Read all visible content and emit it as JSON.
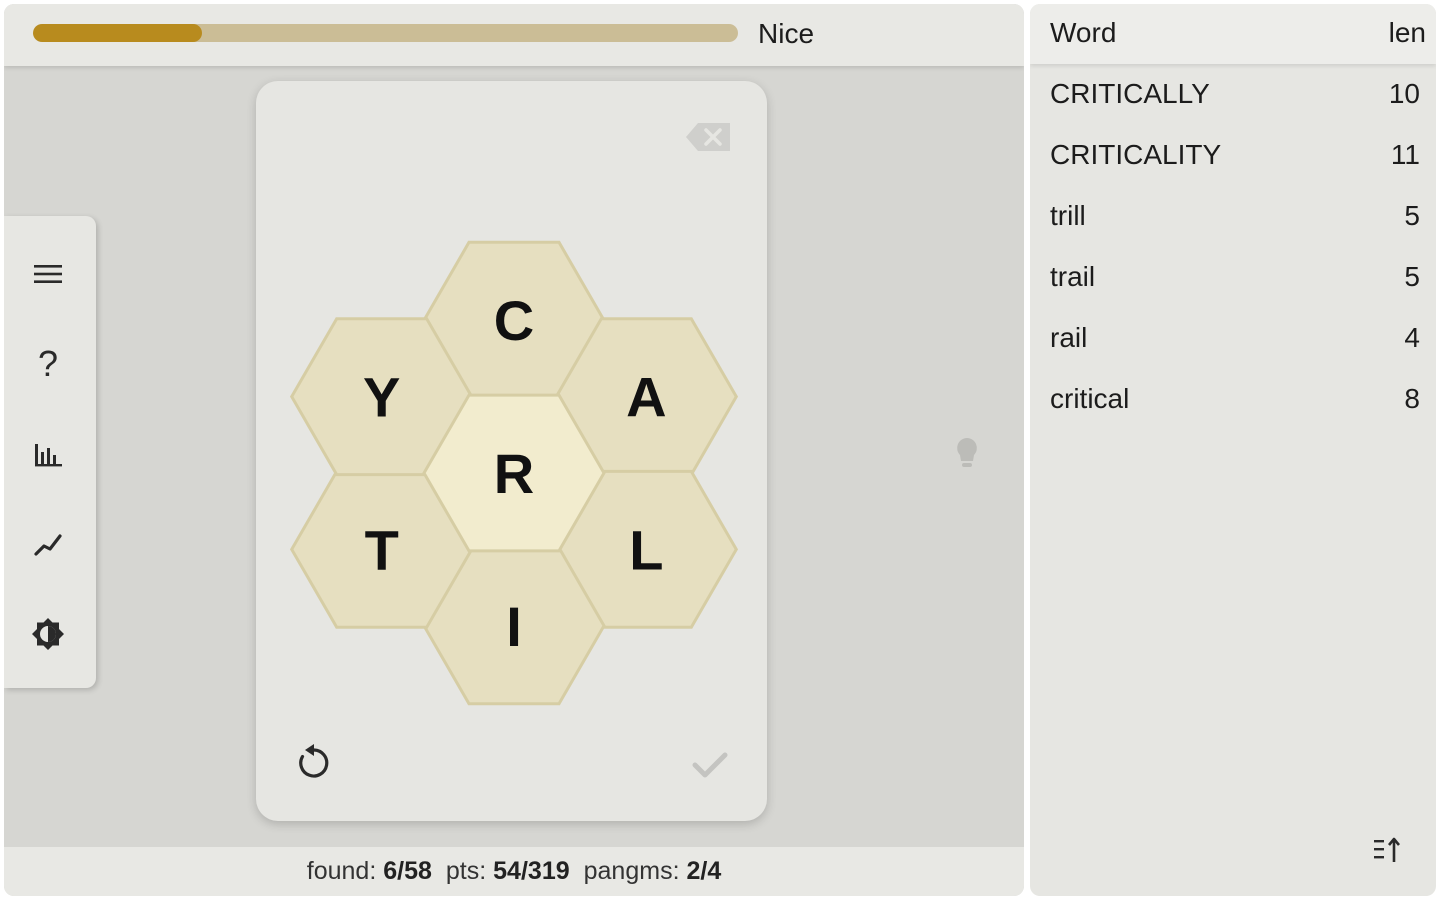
{
  "progress": {
    "fraction": 0.24,
    "rank": "Nice"
  },
  "toolbar": {
    "icons": [
      "menu-icon",
      "help-icon",
      "stats-icon",
      "trend-icon",
      "theme-icon"
    ],
    "help_glyph": "?"
  },
  "hive": {
    "center": "R",
    "outer": [
      "C",
      "A",
      "L",
      "I",
      "T",
      "Y"
    ]
  },
  "status": {
    "found_label": "found:",
    "found": "6/58",
    "pts_label": "pts:",
    "pts": "54/319",
    "pangrams_label": "pangms:",
    "pangrams": "2/4"
  },
  "word_list": {
    "header_word": "Word",
    "header_len": "len",
    "rows": [
      {
        "word": "CRITICALLY",
        "len": "10"
      },
      {
        "word": "CRITICALITY",
        "len": "11"
      },
      {
        "word": "trill",
        "len": "5"
      },
      {
        "word": "trail",
        "len": "5"
      },
      {
        "word": "rail",
        "len": "4"
      },
      {
        "word": "critical",
        "len": "8"
      }
    ]
  },
  "colors": {
    "progress_fill": "#b88b1e",
    "progress_track": "#cbbd96",
    "hex_outer": "#e6dfc0",
    "hex_center": "#f2ecce",
    "hex_stroke": "#d6cda4"
  }
}
